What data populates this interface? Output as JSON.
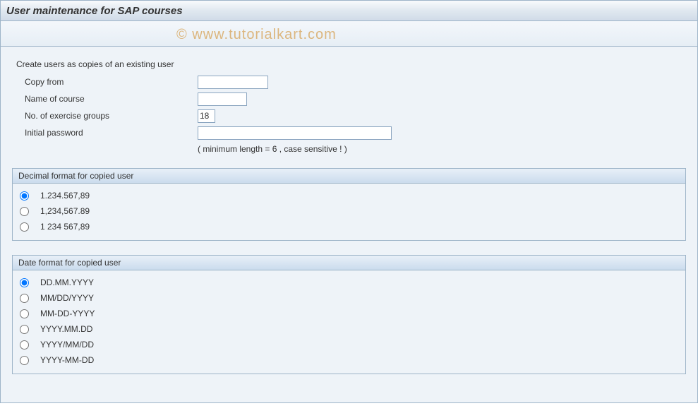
{
  "title": "User maintenance for SAP courses",
  "watermark": "© www.tutorialkart.com",
  "form": {
    "intro": "Create users as copies of an existing user",
    "copy_from_label": "Copy from",
    "copy_from_value": "",
    "course_label": "Name of course",
    "course_value": "",
    "groups_label": "No. of exercise groups",
    "groups_value": "18",
    "password_label": "Initial password",
    "password_value": "",
    "password_hint": "( minimum length = 6 ,  case sensitive ! )"
  },
  "decimal_group": {
    "title": "Decimal format for copied user",
    "options": [
      "1.234.567,89",
      "1,234,567.89",
      "1 234 567,89"
    ],
    "selected": 0
  },
  "date_group": {
    "title": "Date format for copied user",
    "options": [
      "DD.MM.YYYY",
      "MM/DD/YYYY",
      "MM-DD-YYYY",
      "YYYY.MM.DD",
      "YYYY/MM/DD",
      "YYYY-MM-DD"
    ],
    "selected": 0
  }
}
